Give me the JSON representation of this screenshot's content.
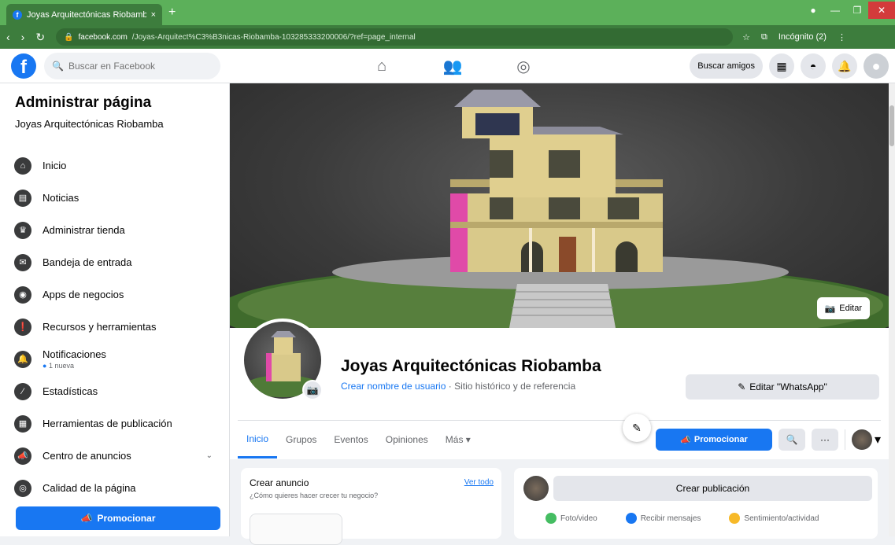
{
  "browser": {
    "tab_title": "Joyas Arquitectónicas Riobamba",
    "tab_close": "×",
    "new_tab": "+",
    "url_domain": "facebook.com",
    "url_path": "/Joyas-Arquitect%C3%B3nicas-Riobamba-103285333200006/?ref=page_internal",
    "profile_label": "Incógnito (2)"
  },
  "header": {
    "search_placeholder": "Buscar en Facebook",
    "find_friends": "Buscar amigos"
  },
  "sidebar": {
    "title": "Administrar página",
    "page_name": "Joyas Arquitectónicas Riobamba",
    "items": [
      {
        "label": "Inicio",
        "icon": "home-icon",
        "glyph": "⌂"
      },
      {
        "label": "Noticias",
        "icon": "news-icon",
        "glyph": "▤"
      },
      {
        "label": "Administrar tienda",
        "icon": "shop-icon",
        "glyph": "♛"
      },
      {
        "label": "Bandeja de entrada",
        "icon": "inbox-icon",
        "glyph": "✉"
      },
      {
        "label": "Apps de negocios",
        "icon": "apps-icon",
        "glyph": "◉"
      },
      {
        "label": "Recursos y herramientas",
        "icon": "tools-icon",
        "glyph": "❗"
      },
      {
        "label": "Notificaciones",
        "sub": "1 nueva",
        "icon": "bell-icon",
        "glyph": "🔔"
      },
      {
        "label": "Estadísticas",
        "icon": "stats-icon",
        "glyph": "⁄"
      },
      {
        "label": "Herramientas de publicación",
        "icon": "publish-icon",
        "glyph": "▦"
      },
      {
        "label": "Centro de anuncios",
        "icon": "megaphone-icon",
        "glyph": "📣"
      },
      {
        "label": "Calidad de la página",
        "icon": "quality-icon",
        "glyph": "◎"
      }
    ],
    "promote_label": "Promocionar"
  },
  "cover": {
    "edit_label": "Editar"
  },
  "profile": {
    "name": "Joyas Arquitectónicas Riobamba",
    "username_link": "Crear nombre de usuario",
    "separator": " · ",
    "category": "Sitio histórico y de referencia",
    "whatsapp_label": "Editar \"WhatsApp\""
  },
  "tabs": [
    "Inicio",
    "Grupos",
    "Eventos",
    "Opiniones",
    "Más ▾"
  ],
  "toolbar": {
    "promote_label": "Promocionar",
    "more": "···"
  },
  "ad_card": {
    "title": "Crear anuncio",
    "subtitle": "¿Cómo quieres hacer crecer tu negocio?",
    "link": "Ver todo"
  },
  "post_card": {
    "create_post": "Crear publicación",
    "actions": [
      "Foto/video",
      "Recibir mensajes",
      "Sentimiento/actividad"
    ]
  },
  "colors": {
    "brand": "#1877f2",
    "browser_chrome": "#3d7d3d"
  }
}
